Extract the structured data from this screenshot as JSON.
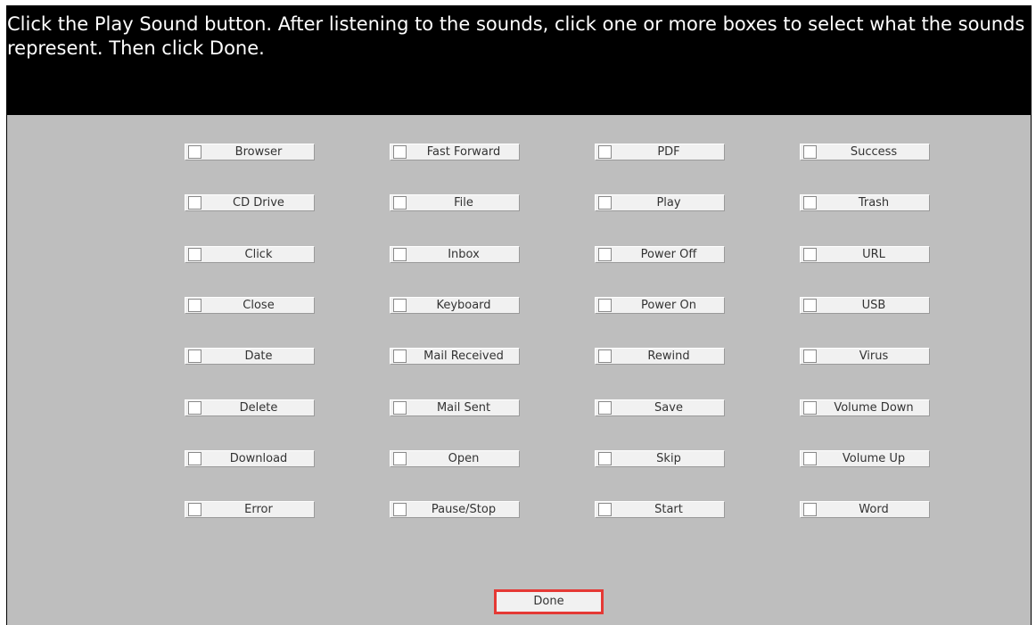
{
  "instruction": "Click the Play Sound button. After listening to the sounds, click one or more boxes to select what the sounds represent. Then click Done.",
  "options": {
    "columns": [
      [
        "Browser",
        "CD Drive",
        "Click",
        "Close",
        "Date",
        "Delete",
        "Download",
        "Error"
      ],
      [
        "Fast Forward",
        "File",
        "Inbox",
        "Keyboard",
        "Mail Received",
        "Mail Sent",
        "Open",
        "Pause/Stop"
      ],
      [
        "PDF",
        "Play",
        "Power Off",
        "Power On",
        "Rewind",
        "Save",
        "Skip",
        "Start"
      ],
      [
        "Success",
        "Trash",
        "URL",
        "USB",
        "Virus",
        "Volume Down",
        "Volume Up",
        "Word"
      ]
    ],
    "checked": []
  },
  "done_label": "Done",
  "colors": {
    "header_bg": "#000000",
    "header_text": "#ffffff",
    "panel_bg": "#bebebe",
    "option_bg": "#f1f1f1",
    "highlight": "#e53935"
  }
}
